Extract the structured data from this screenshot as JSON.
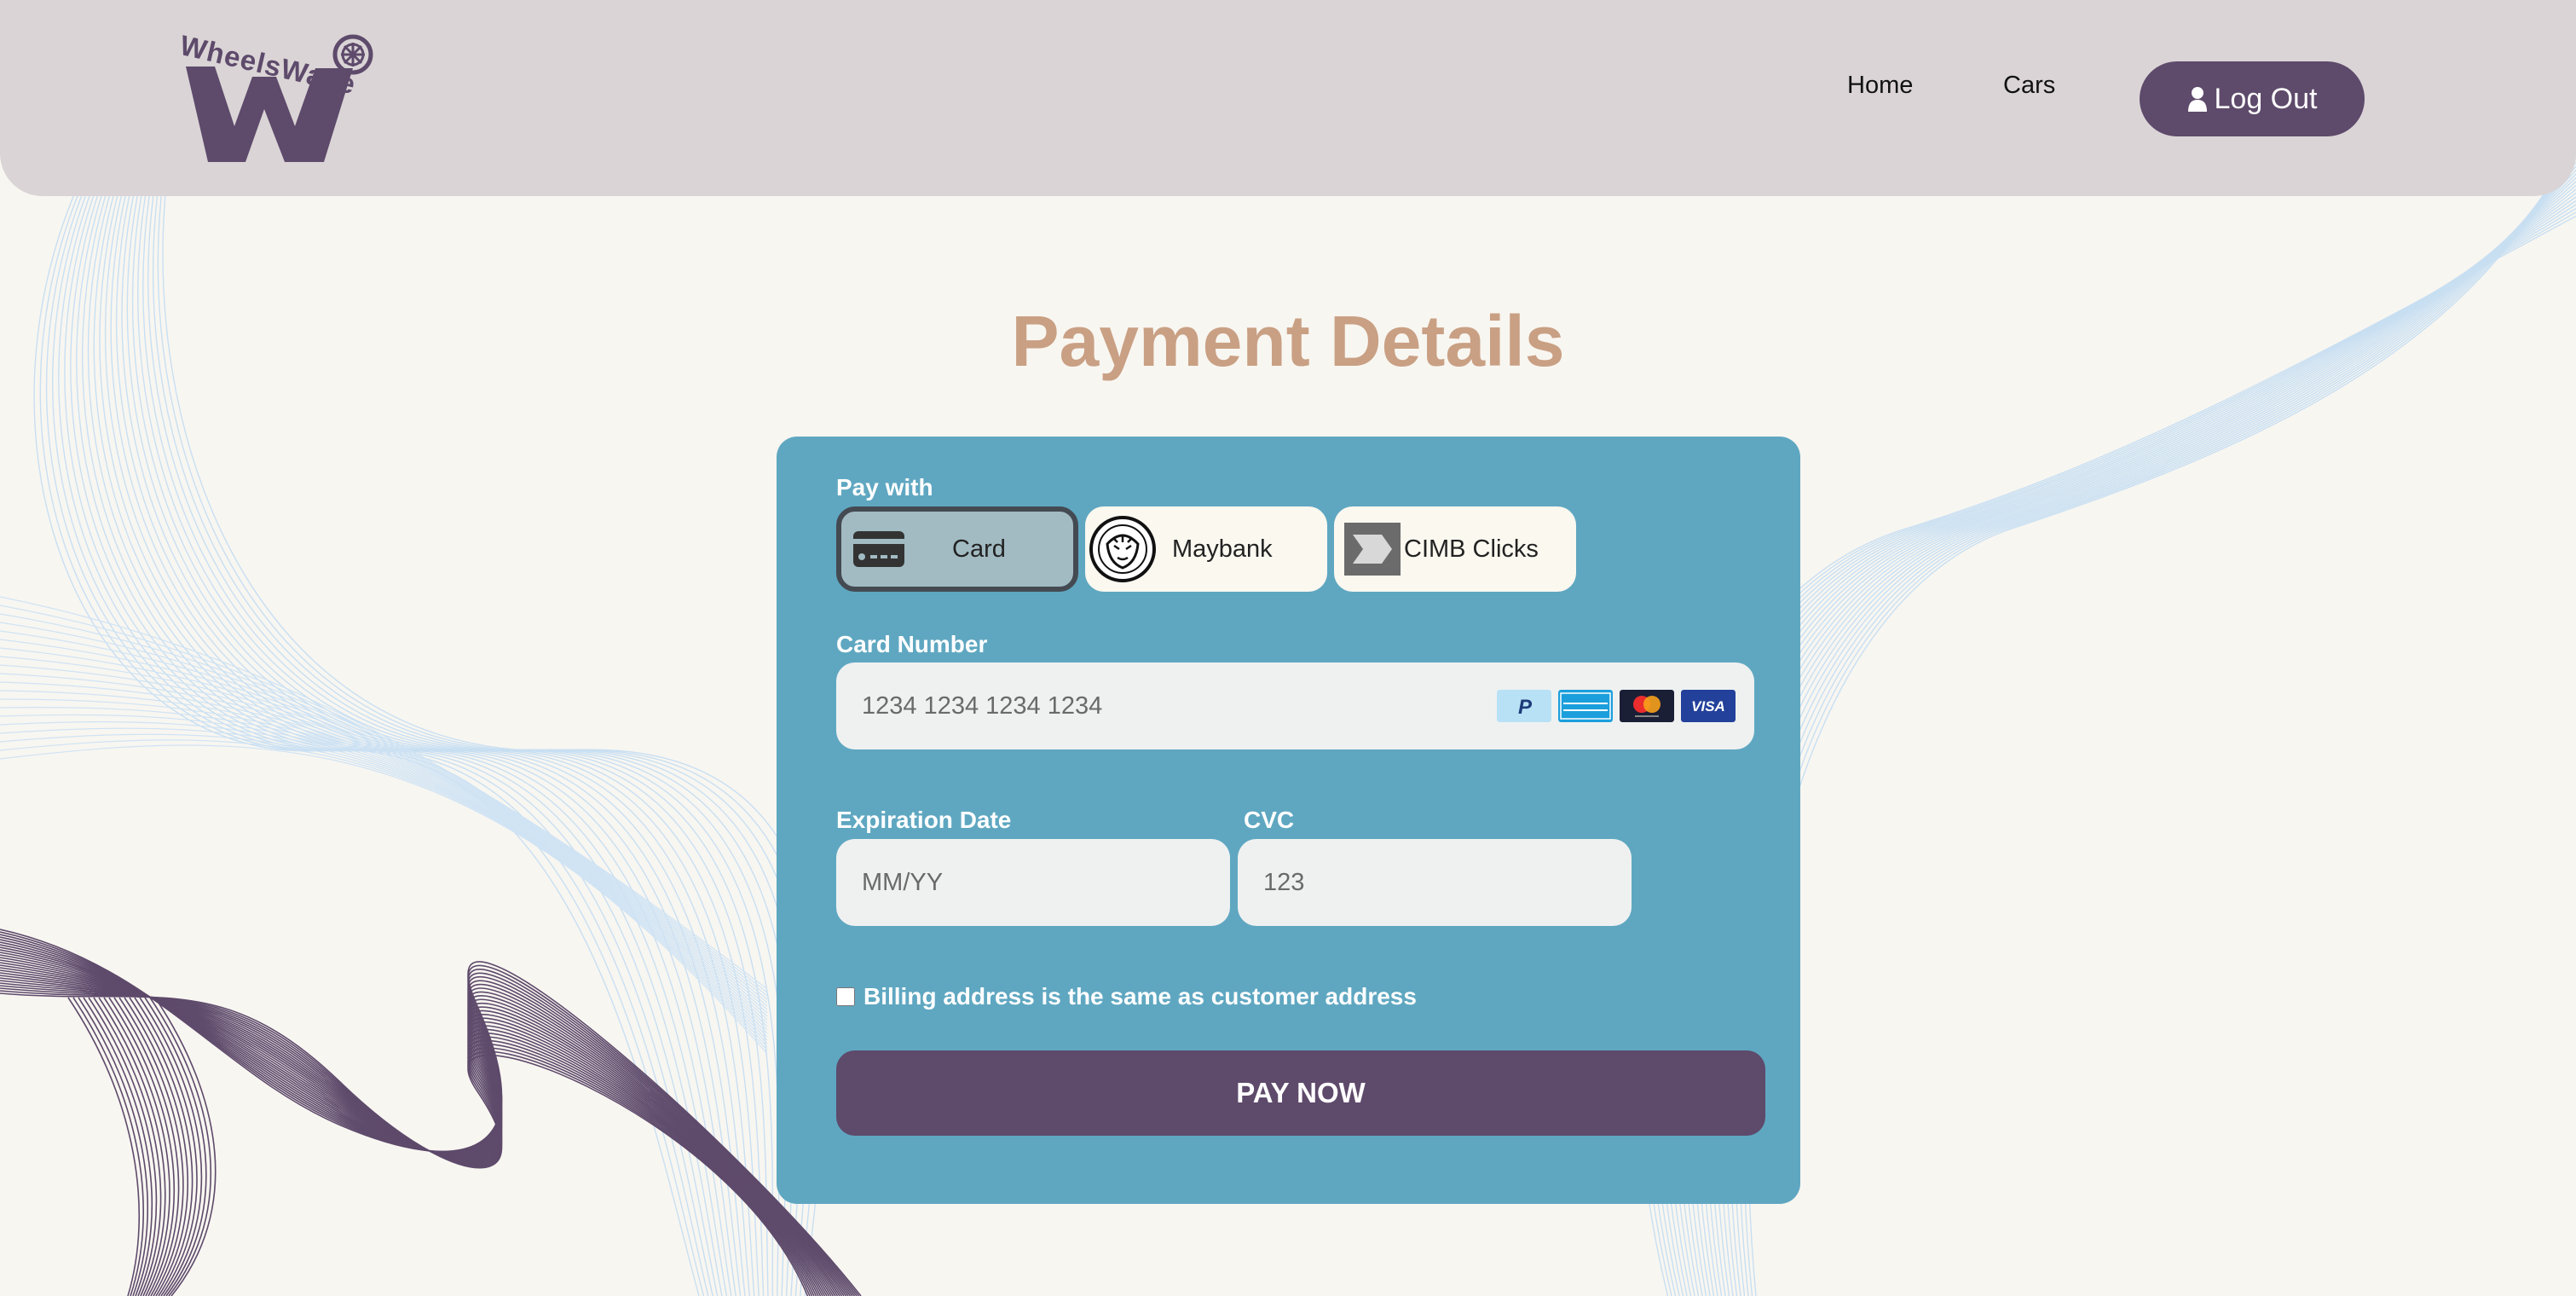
{
  "brand": {
    "name": "WheelsWave"
  },
  "nav": {
    "home": "Home",
    "cars": "Cars",
    "logout": "Log Out"
  },
  "page": {
    "title": "Payment Details"
  },
  "form": {
    "pay_with_label": "Pay with",
    "methods": [
      {
        "label": "Card",
        "selected": true
      },
      {
        "label": "Maybank",
        "selected": false
      },
      {
        "label": "CIMB Clicks",
        "selected": false
      }
    ],
    "card_number_label": "Card Number",
    "card_number_placeholder": "1234 1234 1234 1234",
    "expiration_label": "Expiration Date",
    "expiration_placeholder": "MM/YY",
    "cvc_label": "CVC",
    "cvc_placeholder": "123",
    "billing_label": "Billing address is the same as customer address",
    "billing_checked": false,
    "pay_button": "PAY NOW"
  },
  "icons": {
    "logout": "user-icon",
    "card": "credit-card-icon",
    "maybank": "maybank-tiger-logo",
    "cimb": "cimb-logo",
    "brands": [
      "paypal-icon",
      "american-express-icon",
      "mastercard-icon",
      "visa-icon"
    ]
  },
  "colors": {
    "header_bg": "#dad4d6",
    "brand_purple": "#5e4a6b",
    "title": "#c9a084",
    "panel": "#5fa7c1",
    "page_bg": "#f8f6f1"
  }
}
